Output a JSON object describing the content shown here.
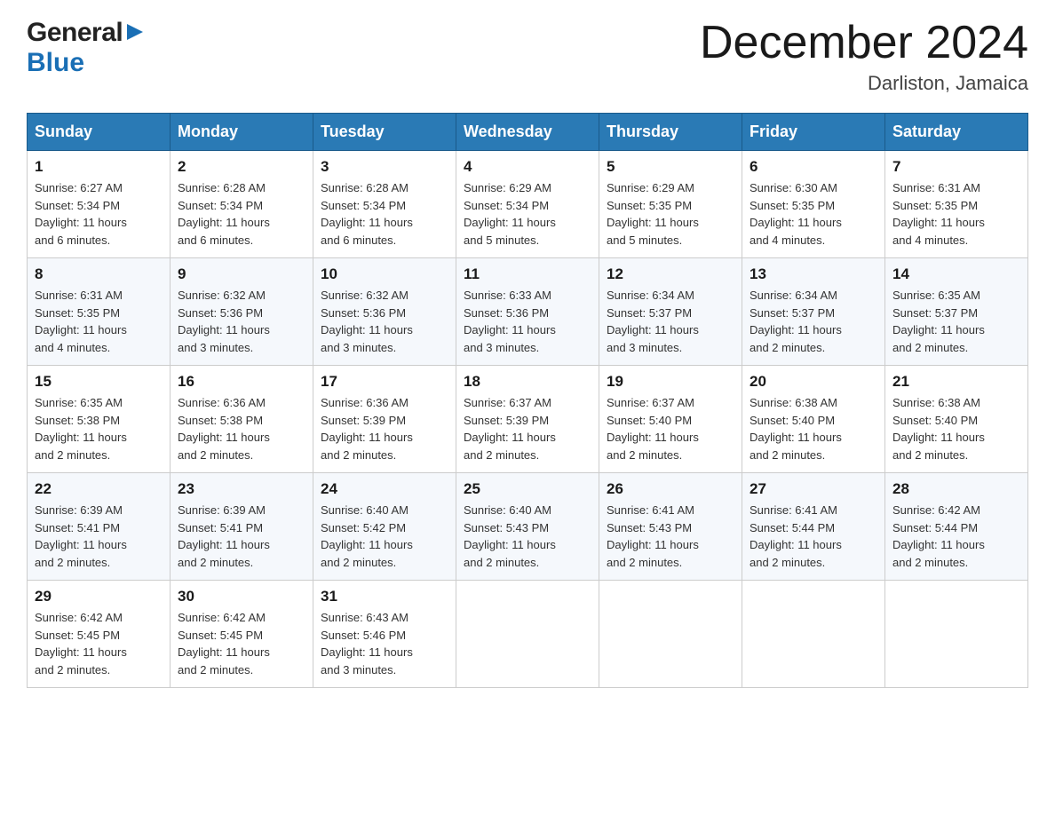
{
  "header": {
    "logo_general": "General",
    "logo_blue": "Blue",
    "month_title": "December 2024",
    "location": "Darliston, Jamaica"
  },
  "days_of_week": [
    "Sunday",
    "Monday",
    "Tuesday",
    "Wednesday",
    "Thursday",
    "Friday",
    "Saturday"
  ],
  "weeks": [
    [
      {
        "day": "1",
        "sunrise": "6:27 AM",
        "sunset": "5:34 PM",
        "daylight": "11 hours and 6 minutes."
      },
      {
        "day": "2",
        "sunrise": "6:28 AM",
        "sunset": "5:34 PM",
        "daylight": "11 hours and 6 minutes."
      },
      {
        "day": "3",
        "sunrise": "6:28 AM",
        "sunset": "5:34 PM",
        "daylight": "11 hours and 6 minutes."
      },
      {
        "day": "4",
        "sunrise": "6:29 AM",
        "sunset": "5:34 PM",
        "daylight": "11 hours and 5 minutes."
      },
      {
        "day": "5",
        "sunrise": "6:29 AM",
        "sunset": "5:35 PM",
        "daylight": "11 hours and 5 minutes."
      },
      {
        "day": "6",
        "sunrise": "6:30 AM",
        "sunset": "5:35 PM",
        "daylight": "11 hours and 4 minutes."
      },
      {
        "day": "7",
        "sunrise": "6:31 AM",
        "sunset": "5:35 PM",
        "daylight": "11 hours and 4 minutes."
      }
    ],
    [
      {
        "day": "8",
        "sunrise": "6:31 AM",
        "sunset": "5:35 PM",
        "daylight": "11 hours and 4 minutes."
      },
      {
        "day": "9",
        "sunrise": "6:32 AM",
        "sunset": "5:36 PM",
        "daylight": "11 hours and 3 minutes."
      },
      {
        "day": "10",
        "sunrise": "6:32 AM",
        "sunset": "5:36 PM",
        "daylight": "11 hours and 3 minutes."
      },
      {
        "day": "11",
        "sunrise": "6:33 AM",
        "sunset": "5:36 PM",
        "daylight": "11 hours and 3 minutes."
      },
      {
        "day": "12",
        "sunrise": "6:34 AM",
        "sunset": "5:37 PM",
        "daylight": "11 hours and 3 minutes."
      },
      {
        "day": "13",
        "sunrise": "6:34 AM",
        "sunset": "5:37 PM",
        "daylight": "11 hours and 2 minutes."
      },
      {
        "day": "14",
        "sunrise": "6:35 AM",
        "sunset": "5:37 PM",
        "daylight": "11 hours and 2 minutes."
      }
    ],
    [
      {
        "day": "15",
        "sunrise": "6:35 AM",
        "sunset": "5:38 PM",
        "daylight": "11 hours and 2 minutes."
      },
      {
        "day": "16",
        "sunrise": "6:36 AM",
        "sunset": "5:38 PM",
        "daylight": "11 hours and 2 minutes."
      },
      {
        "day": "17",
        "sunrise": "6:36 AM",
        "sunset": "5:39 PM",
        "daylight": "11 hours and 2 minutes."
      },
      {
        "day": "18",
        "sunrise": "6:37 AM",
        "sunset": "5:39 PM",
        "daylight": "11 hours and 2 minutes."
      },
      {
        "day": "19",
        "sunrise": "6:37 AM",
        "sunset": "5:40 PM",
        "daylight": "11 hours and 2 minutes."
      },
      {
        "day": "20",
        "sunrise": "6:38 AM",
        "sunset": "5:40 PM",
        "daylight": "11 hours and 2 minutes."
      },
      {
        "day": "21",
        "sunrise": "6:38 AM",
        "sunset": "5:40 PM",
        "daylight": "11 hours and 2 minutes."
      }
    ],
    [
      {
        "day": "22",
        "sunrise": "6:39 AM",
        "sunset": "5:41 PM",
        "daylight": "11 hours and 2 minutes."
      },
      {
        "day": "23",
        "sunrise": "6:39 AM",
        "sunset": "5:41 PM",
        "daylight": "11 hours and 2 minutes."
      },
      {
        "day": "24",
        "sunrise": "6:40 AM",
        "sunset": "5:42 PM",
        "daylight": "11 hours and 2 minutes."
      },
      {
        "day": "25",
        "sunrise": "6:40 AM",
        "sunset": "5:43 PM",
        "daylight": "11 hours and 2 minutes."
      },
      {
        "day": "26",
        "sunrise": "6:41 AM",
        "sunset": "5:43 PM",
        "daylight": "11 hours and 2 minutes."
      },
      {
        "day": "27",
        "sunrise": "6:41 AM",
        "sunset": "5:44 PM",
        "daylight": "11 hours and 2 minutes."
      },
      {
        "day": "28",
        "sunrise": "6:42 AM",
        "sunset": "5:44 PM",
        "daylight": "11 hours and 2 minutes."
      }
    ],
    [
      {
        "day": "29",
        "sunrise": "6:42 AM",
        "sunset": "5:45 PM",
        "daylight": "11 hours and 2 minutes."
      },
      {
        "day": "30",
        "sunrise": "6:42 AM",
        "sunset": "5:45 PM",
        "daylight": "11 hours and 2 minutes."
      },
      {
        "day": "31",
        "sunrise": "6:43 AM",
        "sunset": "5:46 PM",
        "daylight": "11 hours and 3 minutes."
      },
      null,
      null,
      null,
      null
    ]
  ],
  "labels": {
    "sunrise": "Sunrise:",
    "sunset": "Sunset:",
    "daylight": "Daylight:"
  }
}
